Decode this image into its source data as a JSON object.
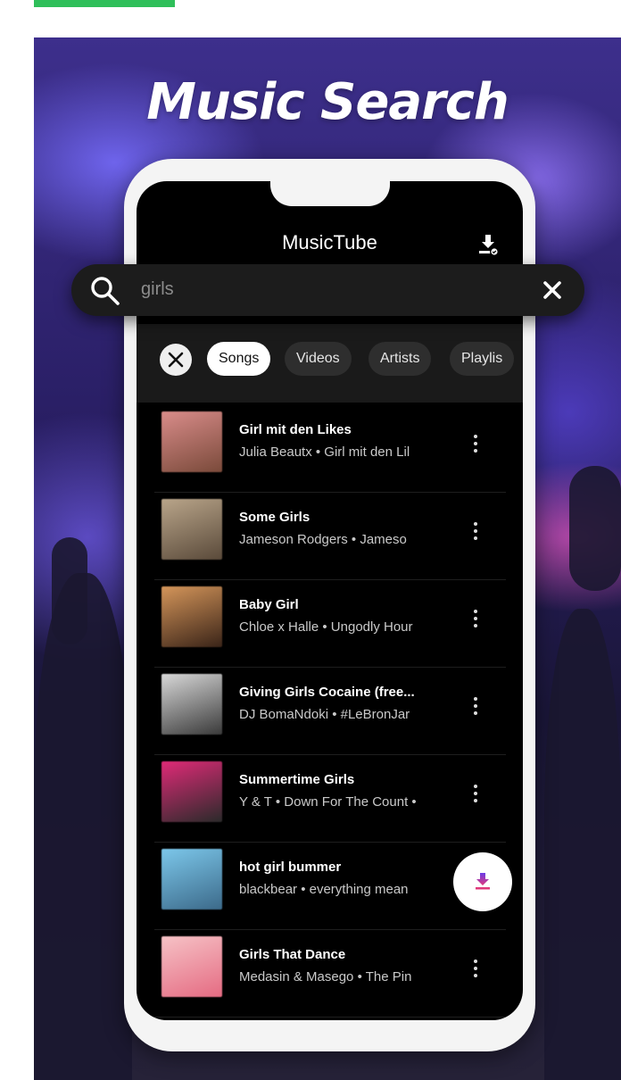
{
  "poster": {
    "title": "Music Search"
  },
  "app": {
    "name": "MusicTube",
    "search": {
      "query": "girls"
    },
    "filters": [
      "Songs",
      "Videos",
      "Artists",
      "Playlis"
    ],
    "selected_filter": "Songs",
    "results": [
      {
        "title": "Girl mit den Likes",
        "subtitle": "Julia Beautx • Girl mit den Lil",
        "thumb_colors": [
          "#d98c8a",
          "#7a4a3a"
        ]
      },
      {
        "title": "Some Girls",
        "subtitle": "Jameson Rodgers • Jameso",
        "thumb_colors": [
          "#b9a58a",
          "#5a4a3a"
        ]
      },
      {
        "title": "Baby Girl",
        "subtitle": "Chloe x Halle • Ungodly Hour",
        "thumb_colors": [
          "#d4955a",
          "#3a2418"
        ]
      },
      {
        "title": "Giving Girls Cocaine (free...",
        "subtitle": "DJ BomaNdoki • #LeBronJar",
        "thumb_colors": [
          "#d8d8d8",
          "#3a3a3a"
        ]
      },
      {
        "title": "Summertime Girls",
        "subtitle": "Y & T • Down For The Count •",
        "thumb_colors": [
          "#e02a77",
          "#2a2a2a"
        ]
      },
      {
        "title": "hot girl bummer",
        "subtitle": "blackbear • everything mean",
        "thumb_colors": [
          "#7cc7ea",
          "#3c6a8a"
        ]
      },
      {
        "title": "Girls That Dance",
        "subtitle": "Medasin & Masego • The Pin",
        "thumb_colors": [
          "#f6c2c6",
          "#e56b82"
        ]
      }
    ]
  },
  "colors": {
    "accent_pink": "#e0387a",
    "accent_purple": "#6a3de8"
  },
  "icons": {
    "top_download": "download-icon",
    "search": "search-icon",
    "clear_search": "close-icon",
    "clear_filters": "close-icon",
    "more": "more-vertical-icon",
    "fab": "download-icon"
  }
}
